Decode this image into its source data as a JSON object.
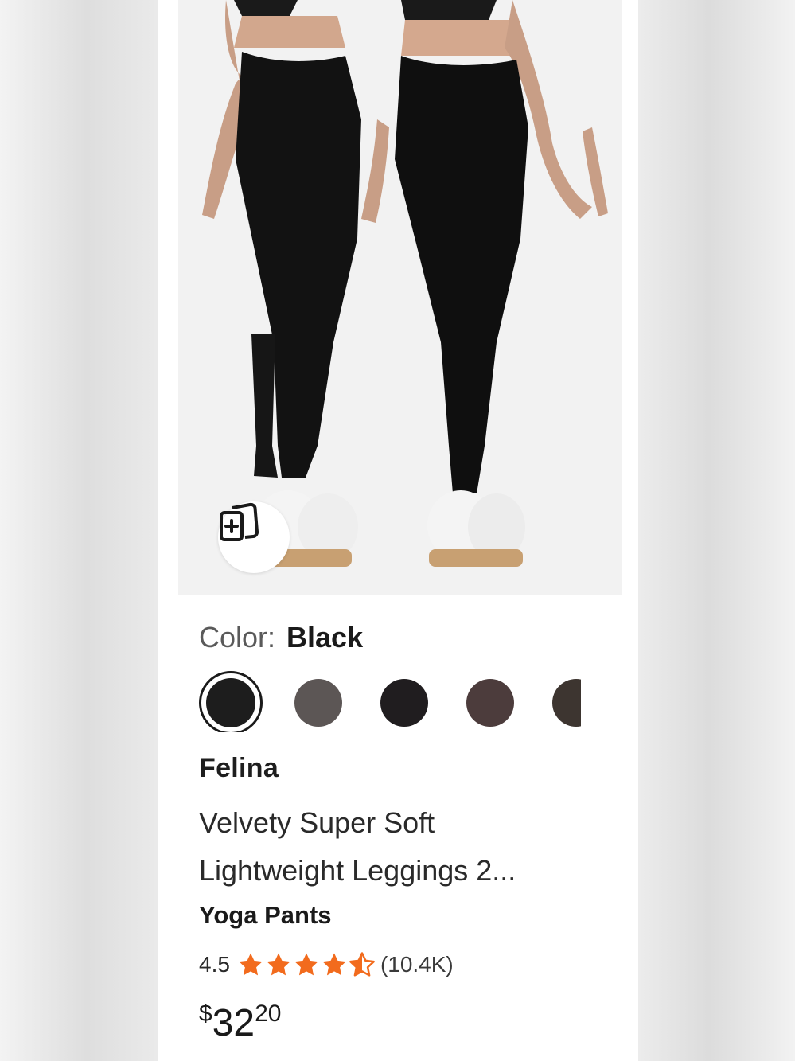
{
  "product": {
    "color_label": "Color:",
    "color_value": "Black",
    "swatches": [
      {
        "name": "Black",
        "hex": "#1d1d1d",
        "selected": true
      },
      {
        "name": "Charcoal",
        "hex": "#5c5655"
      },
      {
        "name": "Jet",
        "hex": "#201d1f"
      },
      {
        "name": "Espresso",
        "hex": "#4c3c3c"
      },
      {
        "name": "Brown",
        "hex": "#3d3530"
      }
    ],
    "brand": "Felina",
    "title_line1": "Velvety Super Soft",
    "title_line2": "Lightweight Leggings 2...",
    "category": "Yoga Pants",
    "rating": "4.5",
    "review_count": "(10.4K)",
    "price_currency": "$",
    "price_dollars": "32",
    "price_cents": "20",
    "star_color": "#f26b1d"
  },
  "icons": {
    "compare": "compare-cards-icon",
    "star": "star-icon"
  }
}
